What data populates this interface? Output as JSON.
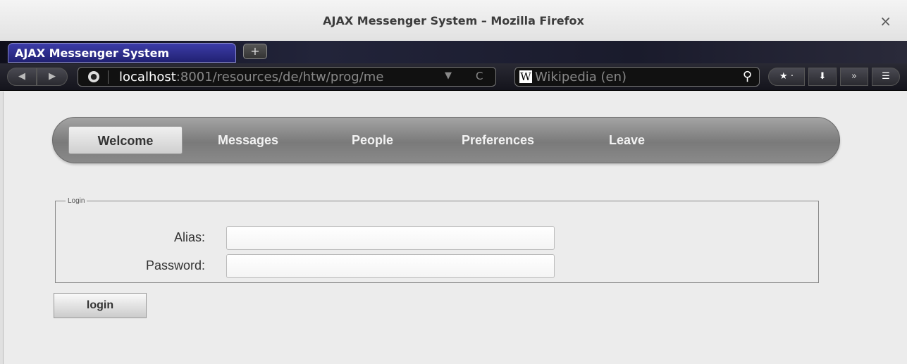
{
  "window": {
    "title": "AJAX Messenger System – Mozilla Firefox",
    "close_glyph": "×"
  },
  "tabs": [
    {
      "label": "AJAX Messenger System"
    }
  ],
  "newtab_glyph": "+",
  "navigation": {
    "back_glyph": "◀",
    "forward_glyph": "▶",
    "url_host": "localhost",
    "url_rest": ":8001/resources/de/htw/prog/me",
    "url_dropdown_glyph": "▼",
    "reload_glyph": "C",
    "search_engine_icon": "W",
    "search_placeholder": "Wikipedia (en)",
    "search_glyph": "⚲",
    "bookmark_glyph": "★ ·",
    "download_glyph": "⬇",
    "overflow_glyph": "»",
    "menu_glyph": "☰"
  },
  "app_nav": {
    "items": [
      "Welcome",
      "Messages",
      "People",
      "Preferences",
      "Leave"
    ],
    "active": "Welcome"
  },
  "login": {
    "legend": "Login",
    "alias_label": "Alias:",
    "alias_value": "",
    "password_label": "Password:",
    "password_value": "",
    "button_label": "login"
  }
}
